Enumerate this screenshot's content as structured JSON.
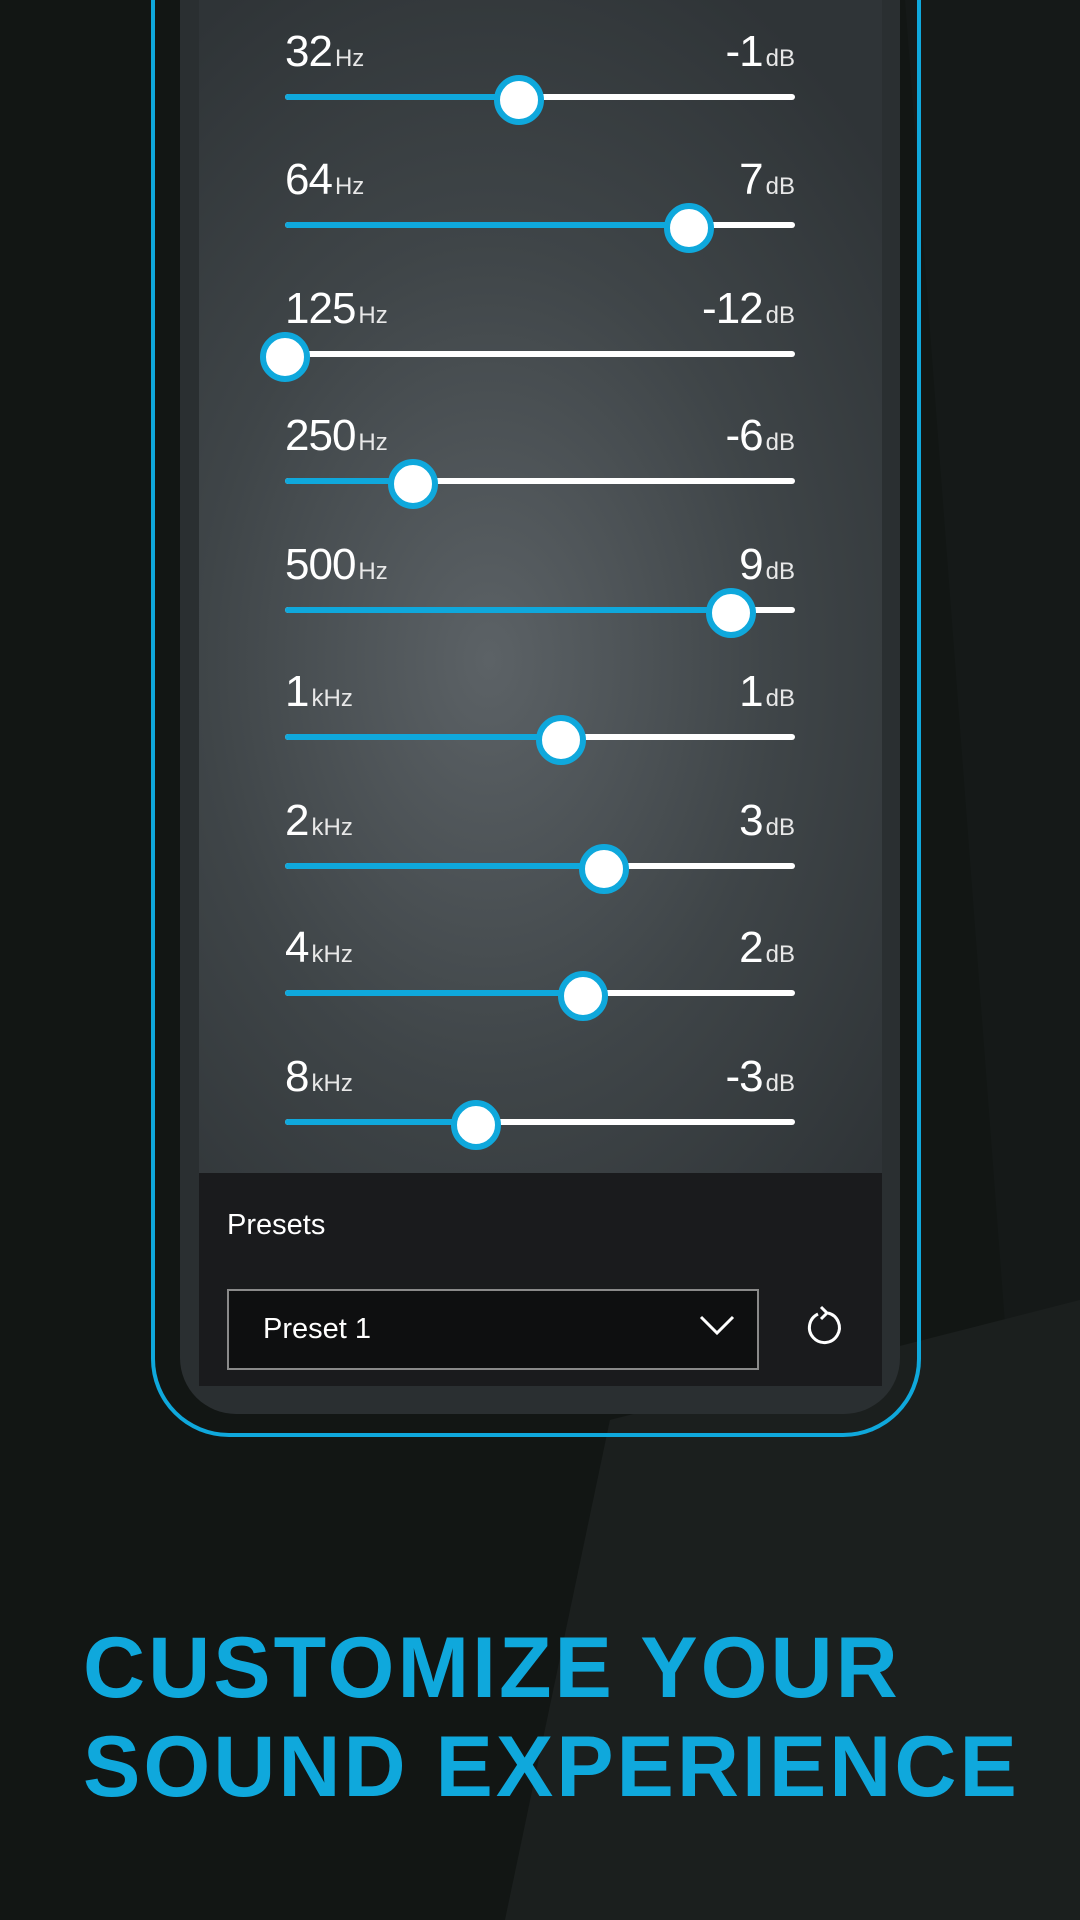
{
  "equalizer": {
    "range_db": [
      -12,
      12
    ],
    "accent_color": "#0fa8dc",
    "bands": [
      {
        "freq": "32",
        "unit": "Hz",
        "gain": "-1",
        "gain_unit": "dB",
        "value": -1
      },
      {
        "freq": "64",
        "unit": "Hz",
        "gain": "7",
        "gain_unit": "dB",
        "value": 7
      },
      {
        "freq": "125",
        "unit": "Hz",
        "gain": "-12",
        "gain_unit": "dB",
        "value": -12
      },
      {
        "freq": "250",
        "unit": "Hz",
        "gain": "-6",
        "gain_unit": "dB",
        "value": -6
      },
      {
        "freq": "500",
        "unit": "Hz",
        "gain": "9",
        "gain_unit": "dB",
        "value": 9
      },
      {
        "freq": "1",
        "unit": "kHz",
        "gain": "1",
        "gain_unit": "dB",
        "value": 1
      },
      {
        "freq": "2",
        "unit": "kHz",
        "gain": "3",
        "gain_unit": "dB",
        "value": 3
      },
      {
        "freq": "4",
        "unit": "kHz",
        "gain": "2",
        "gain_unit": "dB",
        "value": 2
      },
      {
        "freq": "8",
        "unit": "kHz",
        "gain": "-3",
        "gain_unit": "dB",
        "value": -3
      }
    ]
  },
  "presets": {
    "label": "Presets",
    "selected": "Preset 1",
    "dropdown_icon": "chevron-down-icon",
    "reset_icon": "reset-icon"
  },
  "headline": {
    "line1": "CUSTOMIZE YOUR",
    "line2": "SOUND EXPERIENCE"
  }
}
